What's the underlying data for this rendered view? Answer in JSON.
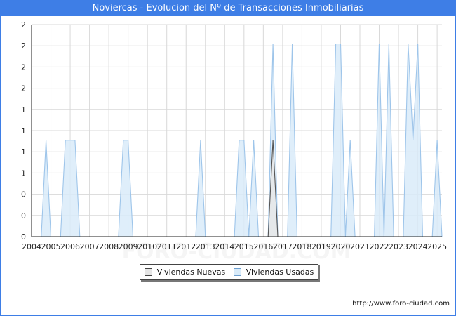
{
  "header": {
    "title": "Noviercas - Evolucion del Nº de Transacciones Inmobiliarias"
  },
  "footer": {
    "source": "http://www.foro-ciudad.com"
  },
  "watermark": "FORO-CIUDAD.COM",
  "chart_data": {
    "type": "area",
    "title": "Noviercas - Evolucion del Nº de Transacciones Inmobiliarias",
    "xlabel": "",
    "ylabel": "",
    "x_ticks": [
      "2004",
      "2005",
      "2006",
      "2007",
      "2008",
      "2009",
      "2010",
      "2011",
      "2012",
      "2013",
      "2014",
      "2015",
      "2016",
      "2017",
      "2018",
      "2019",
      "2020",
      "2021",
      "2022",
      "2023",
      "2024",
      "2025"
    ],
    "y_ticks": [
      "0",
      "0",
      "0",
      "1",
      "1",
      "1",
      "1",
      "2",
      "2",
      "2",
      "2"
    ],
    "ylim": [
      0,
      2.2
    ],
    "grid": true,
    "legend_position": "bottom",
    "series": [
      {
        "name": "Viviendas Nuevas",
        "color": "#e6e6e6",
        "stroke": "#555555",
        "points": [
          [
            2016.25,
            0
          ],
          [
            2016.5,
            1
          ],
          [
            2016.75,
            0
          ]
        ]
      },
      {
        "name": "Viviendas Usadas",
        "color": "#d9ebf9",
        "stroke": "#9ec5ea",
        "points": [
          [
            2004.5,
            0
          ],
          [
            2004.75,
            1
          ],
          [
            2005.0,
            0
          ],
          [
            2005.5,
            0
          ],
          [
            2005.75,
            1
          ],
          [
            2006.25,
            1
          ],
          [
            2006.5,
            0
          ],
          [
            2008.5,
            0
          ],
          [
            2008.75,
            1
          ],
          [
            2009.0,
            1
          ],
          [
            2009.25,
            0
          ],
          [
            2012.5,
            0
          ],
          [
            2012.75,
            1
          ],
          [
            2013.0,
            0
          ],
          [
            2014.5,
            0
          ],
          [
            2014.75,
            1
          ],
          [
            2015.0,
            1
          ],
          [
            2015.25,
            0
          ],
          [
            2015.5,
            1
          ],
          [
            2015.75,
            0
          ],
          [
            2016.25,
            0
          ],
          [
            2016.5,
            2
          ],
          [
            2016.75,
            0
          ],
          [
            2017.25,
            0
          ],
          [
            2017.5,
            2
          ],
          [
            2017.75,
            0
          ],
          [
            2019.5,
            0
          ],
          [
            2019.75,
            2
          ],
          [
            2020.0,
            2
          ],
          [
            2020.25,
            0
          ],
          [
            2020.5,
            1
          ],
          [
            2020.75,
            0
          ],
          [
            2021.75,
            0
          ],
          [
            2022.0,
            2
          ],
          [
            2022.25,
            0
          ],
          [
            2022.5,
            2
          ],
          [
            2022.75,
            0
          ],
          [
            2023.25,
            0
          ],
          [
            2023.5,
            2
          ],
          [
            2023.75,
            1
          ],
          [
            2024.0,
            2
          ],
          [
            2024.25,
            0
          ],
          [
            2024.75,
            0
          ],
          [
            2025.0,
            1
          ],
          [
            2025.25,
            0
          ]
        ]
      }
    ]
  }
}
